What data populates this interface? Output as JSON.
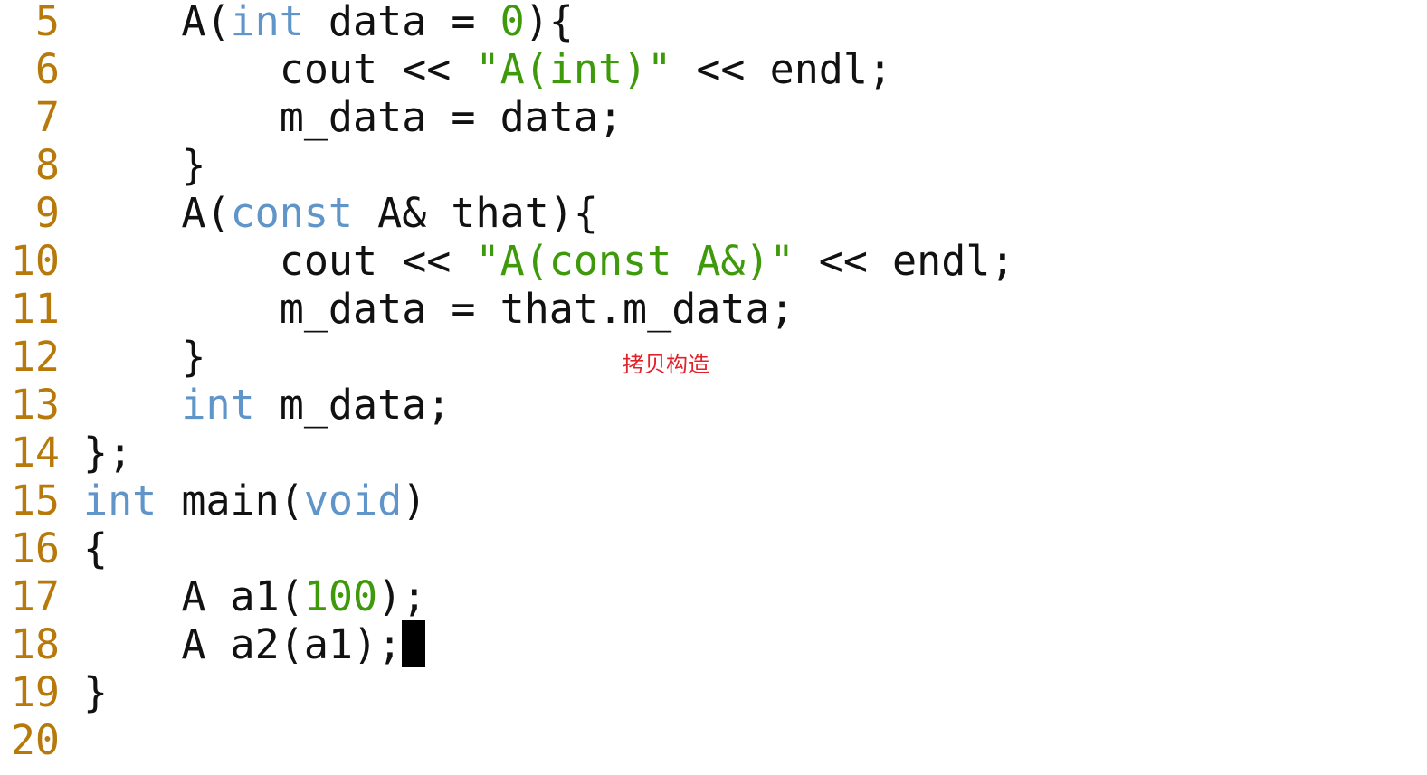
{
  "editor": {
    "lines": [
      {
        "number": "5",
        "segments": [
          {
            "t": "    A(",
            "c": "plain"
          },
          {
            "t": "int",
            "c": "kw"
          },
          {
            "t": " data = ",
            "c": "plain"
          },
          {
            "t": "0",
            "c": "num"
          },
          {
            "t": "){",
            "c": "plain"
          }
        ]
      },
      {
        "number": "6",
        "segments": [
          {
            "t": "        cout << ",
            "c": "plain"
          },
          {
            "t": "\"A(int)\"",
            "c": "str"
          },
          {
            "t": " << endl;",
            "c": "plain"
          }
        ]
      },
      {
        "number": "7",
        "segments": [
          {
            "t": "        m_data = data;",
            "c": "plain"
          }
        ]
      },
      {
        "number": "8",
        "segments": [
          {
            "t": "    }",
            "c": "plain"
          }
        ]
      },
      {
        "number": "9",
        "segments": [
          {
            "t": "    A(",
            "c": "plain"
          },
          {
            "t": "const",
            "c": "kw"
          },
          {
            "t": " A& that){",
            "c": "plain"
          }
        ]
      },
      {
        "number": "10",
        "segments": [
          {
            "t": "        cout << ",
            "c": "plain"
          },
          {
            "t": "\"A(const A&)\"",
            "c": "str"
          },
          {
            "t": " << endl;",
            "c": "plain"
          }
        ]
      },
      {
        "number": "11",
        "segments": [
          {
            "t": "        m_data = that.m_data;",
            "c": "plain"
          }
        ]
      },
      {
        "number": "12",
        "segments": [
          {
            "t": "    }",
            "c": "plain"
          }
        ]
      },
      {
        "number": "13",
        "segments": [
          {
            "t": "    ",
            "c": "plain"
          },
          {
            "t": "int",
            "c": "kw"
          },
          {
            "t": " m_data;",
            "c": "plain"
          }
        ]
      },
      {
        "number": "14",
        "segments": [
          {
            "t": "};",
            "c": "plain"
          }
        ]
      },
      {
        "number": "15",
        "segments": [
          {
            "t": "int",
            "c": "kw"
          },
          {
            "t": " main(",
            "c": "plain"
          },
          {
            "t": "void",
            "c": "kw"
          },
          {
            "t": ")",
            "c": "plain"
          }
        ]
      },
      {
        "number": "16",
        "segments": [
          {
            "t": "{",
            "c": "plain"
          }
        ]
      },
      {
        "number": "17",
        "segments": [
          {
            "t": "    A a1(",
            "c": "plain"
          },
          {
            "t": "100",
            "c": "num"
          },
          {
            "t": ");",
            "c": "plain"
          }
        ]
      },
      {
        "number": "18",
        "segments": [
          {
            "t": "    A a2(a1);",
            "c": "plain"
          }
        ],
        "cursor": true
      },
      {
        "number": "19",
        "segments": [
          {
            "t": "}",
            "c": "plain"
          }
        ]
      },
      {
        "number": "20",
        "segments": []
      }
    ]
  },
  "annotation": {
    "text": "拷贝构造"
  },
  "colors": {
    "line_number": "#b8790b",
    "keyword": "#5f95c8",
    "literal": "#3e9a0b",
    "text": "#111111",
    "annotation": "#e2222a",
    "background": "#ffffff"
  }
}
